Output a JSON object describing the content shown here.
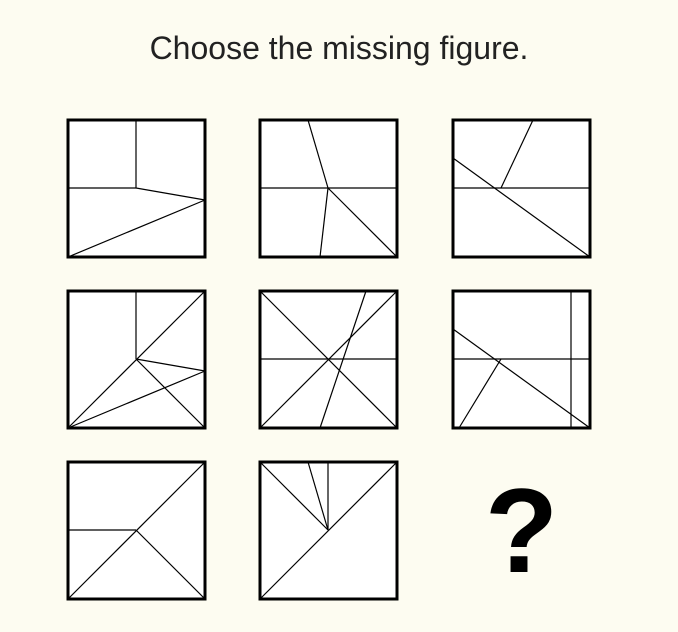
{
  "title": "Choose the missing figure.",
  "missing_symbol": "?",
  "colors": {
    "background": "#fdfcf1",
    "stroke": "#000000"
  }
}
